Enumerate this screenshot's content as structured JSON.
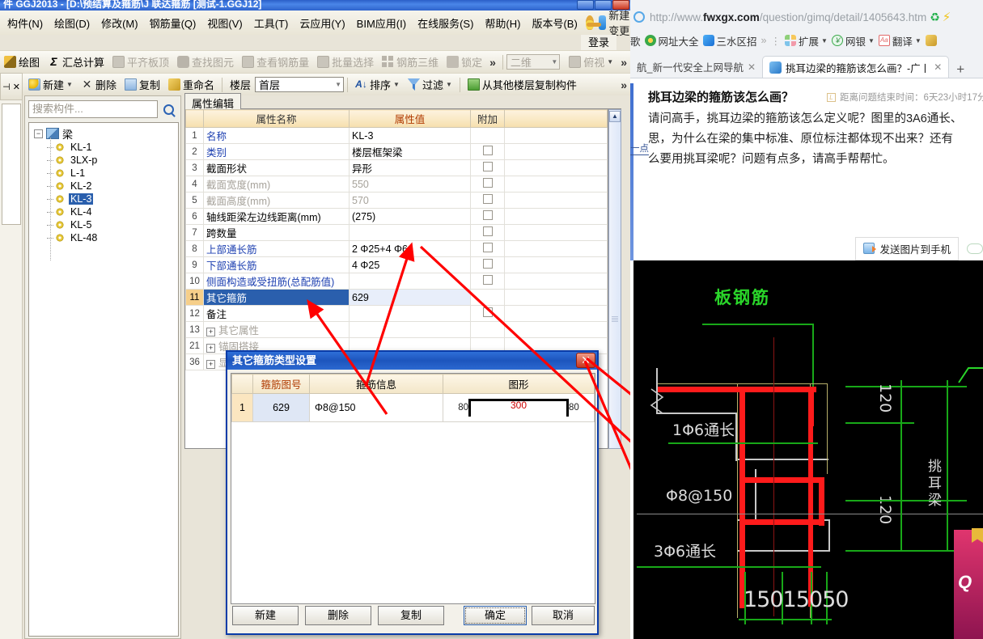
{
  "app": {
    "title": "件 GGJ2013 - [D:\\预结算及箍筋\\J 联达箍筋 [测试-1.GGJ12]",
    "menu": [
      "构件(N)",
      "绘图(D)",
      "修改(M)",
      "钢筋量(Q)",
      "视图(V)",
      "工具(T)",
      "云应用(Y)",
      "BIM应用(I)",
      "在线服务(S)",
      "帮助(H)",
      "版本号(B)"
    ],
    "new_change_label": "新建变更",
    "login_label": "登录",
    "toolbar1": [
      {
        "label": "绘图",
        "icon": "pencil-icon",
        "dim": false
      },
      {
        "label": "汇总计算",
        "icon": "sigma-icon",
        "dim": false
      },
      {
        "label": "平齐板顶",
        "icon": "level-slab-icon",
        "dim": true
      },
      {
        "label": "查找图元",
        "icon": "binocular-icon",
        "dim": true
      },
      {
        "label": "查看钢筋量",
        "icon": "rebar-view-icon",
        "dim": true
      },
      {
        "label": "批量选择",
        "icon": "batch-select-icon",
        "dim": true
      },
      {
        "label": "钢筋三维",
        "icon": "rebar-3d-icon",
        "dim": true
      },
      {
        "label": "锁定",
        "icon": "lock-icon",
        "dim": true
      }
    ],
    "toolbar1_overflow": "»",
    "view_mode": "二维",
    "view_angle": "俯视",
    "toolbar2": [
      {
        "label": "新建",
        "icon": "new-icon",
        "caret": true
      },
      {
        "label": "删除",
        "icon": "delete-x-icon",
        "caret": false
      },
      {
        "label": "复制",
        "icon": "copy-icon",
        "caret": false
      },
      {
        "label": "重命名",
        "icon": "rename-icon",
        "caret": false
      }
    ],
    "floor_label": "楼层",
    "floor_value": "首层",
    "sort_label": "排序",
    "filter_label": "过滤",
    "copy_from_floor_label": "从其他楼层复制构件",
    "toolbar2_overflow": "»"
  },
  "nav": {
    "search_placeholder": "搜索构件...",
    "search_icon": "magnifier-icon",
    "root_label": "梁",
    "items": [
      {
        "label": "KL-1",
        "selected": false
      },
      {
        "label": "3LX-p",
        "selected": false
      },
      {
        "label": "L-1",
        "selected": false
      },
      {
        "label": "KL-2",
        "selected": false
      },
      {
        "label": "KL-3",
        "selected": true
      },
      {
        "label": "KL-4",
        "selected": false
      },
      {
        "label": "KL-5",
        "selected": false
      },
      {
        "label": "KL-48",
        "selected": false
      }
    ]
  },
  "props": {
    "tab_label": "属性编辑",
    "headers": [
      "",
      "属性名称",
      "属性值",
      "附加"
    ],
    "rows": [
      {
        "n": "1",
        "name": "名称",
        "value": "KL-3",
        "attach": false,
        "blue": true,
        "gray": false,
        "sel": false,
        "expand": false
      },
      {
        "n": "2",
        "name": "类别",
        "value": "楼层框架梁",
        "attach": true,
        "blue": true,
        "gray": false,
        "sel": false,
        "expand": false
      },
      {
        "n": "3",
        "name": "截面形状",
        "value": "异形",
        "attach": true,
        "blue": false,
        "gray": false,
        "sel": false,
        "expand": false
      },
      {
        "n": "4",
        "name": "截面宽度(mm)",
        "value": "550",
        "attach": true,
        "blue": false,
        "gray": true,
        "sel": false,
        "expand": false
      },
      {
        "n": "5",
        "name": "截面高度(mm)",
        "value": "570",
        "attach": true,
        "blue": false,
        "gray": true,
        "sel": false,
        "expand": false
      },
      {
        "n": "6",
        "name": "轴线距梁左边线距离(mm)",
        "value": "(275)",
        "attach": true,
        "blue": false,
        "gray": false,
        "sel": false,
        "expand": false
      },
      {
        "n": "7",
        "name": "跨数量",
        "value": "",
        "attach": true,
        "blue": false,
        "gray": false,
        "sel": false,
        "expand": false
      },
      {
        "n": "8",
        "name": "上部通长筋",
        "value": "2 Φ25+4 Φ6",
        "attach": true,
        "blue": true,
        "gray": false,
        "sel": false,
        "expand": false
      },
      {
        "n": "9",
        "name": "下部通长筋",
        "value": "4 Φ25",
        "attach": true,
        "blue": true,
        "gray": false,
        "sel": false,
        "expand": false
      },
      {
        "n": "10",
        "name": "侧面构造或受扭筋(总配筋值)",
        "value": "",
        "attach": true,
        "blue": true,
        "gray": false,
        "sel": false,
        "expand": false
      },
      {
        "n": "11",
        "name": "其它箍筋",
        "value": "629",
        "attach": false,
        "blue": false,
        "gray": false,
        "sel": true,
        "expand": false
      },
      {
        "n": "12",
        "name": "备注",
        "value": "",
        "attach": true,
        "blue": false,
        "gray": false,
        "sel": false,
        "expand": false
      },
      {
        "n": "13",
        "name": "其它属性",
        "value": "",
        "attach": false,
        "blue": false,
        "gray": true,
        "sel": false,
        "expand": true
      },
      {
        "n": "21",
        "name": "锚固搭接",
        "value": "",
        "attach": false,
        "blue": false,
        "gray": true,
        "sel": false,
        "expand": true
      },
      {
        "n": "36",
        "name": "显示样式",
        "value": "",
        "attach": false,
        "blue": false,
        "gray": true,
        "sel": false,
        "expand": true
      }
    ]
  },
  "dialog": {
    "title": "其它箍筋类型设置",
    "close_icon": "close-icon",
    "headers": [
      "",
      "箍筋图号",
      "箍筋信息",
      "图形"
    ],
    "rows": [
      {
        "n": "1",
        "code": "629",
        "info": "Φ8@150",
        "left_dim": "80",
        "mid_dim": "300",
        "right_dim": "80"
      }
    ],
    "buttons_left": [
      "新建",
      "删除",
      "复制"
    ],
    "buttons_right": [
      "确定",
      "取消"
    ],
    "default_button": "确定"
  },
  "browser": {
    "url_prefix": "http://www.",
    "url_domain": "fwxgx.com",
    "url_path": "/question/gimq/detail/1405643.htm",
    "refresh_icon": "refresh-icon",
    "bolt_icon": "bolt-icon",
    "bookmarks": [
      {
        "label": "歌",
        "icon": "bookmark-icon-1"
      },
      {
        "label": "网址大全",
        "icon": "bookmark-icon-2"
      },
      {
        "label": "三水区招",
        "icon": "bookmark-icon-3"
      },
      {
        "label": "»",
        "icon": "overflow-icon"
      }
    ],
    "ext_buttons": [
      {
        "label": "扩展",
        "icon": "extensions-icon"
      },
      {
        "label": "网银",
        "icon": "bank-icon"
      },
      {
        "label": "翻译",
        "icon": "translate-icon"
      }
    ],
    "tabs": [
      {
        "label": "航_新一代安全上网导航",
        "active": false,
        "close_icon": "close-icon"
      },
      {
        "label": "挑耳边梁的箍筋该怎么画？-广ㅣ",
        "active": true,
        "close_icon": "close-icon"
      }
    ],
    "new_tab_label": "+"
  },
  "page": {
    "question_title": "挑耳边梁的箍筋该怎么画？",
    "timer_icon": "clock-icon",
    "timer_text": "距离问题结束时间：6天23小时17分",
    "body_lines": [
      "请问高手，挑耳边梁的箍筋该怎么定义呢？图里的3A6通长、",
      "思，为什么在梁的集中标准、原位标注都体现不出来？还有",
      "么要用挑耳梁呢？问题有点多，请高手帮帮忙。"
    ],
    "side_link": "一点",
    "send_to_phone_label": "发送图片到手机",
    "send_icon": "send-to-phone-icon",
    "cloud_icon": "cloud-icon"
  },
  "cad": {
    "labels": [
      {
        "text": "板钢筋",
        "color": "green"
      },
      {
        "text": "1Φ6通长",
        "color": "white"
      },
      {
        "text": "Φ8@150",
        "color": "white"
      },
      {
        "text": "3Φ6通长",
        "color": "white"
      },
      {
        "text": "120",
        "color": "white"
      },
      {
        "text": "120",
        "color": "white"
      },
      {
        "text": "15015050",
        "color": "white"
      },
      {
        "text": "挑耳梁",
        "color": "white"
      }
    ],
    "dim_top": "120",
    "dim_bottom": "120",
    "dim_baseline": "15015050",
    "slab_label": "板钢筋",
    "note1": "1Φ6通长",
    "note2": "Φ8@150",
    "note3": "3Φ6通长",
    "vert_note": "挑耳梁",
    "ad_text": "Q"
  }
}
